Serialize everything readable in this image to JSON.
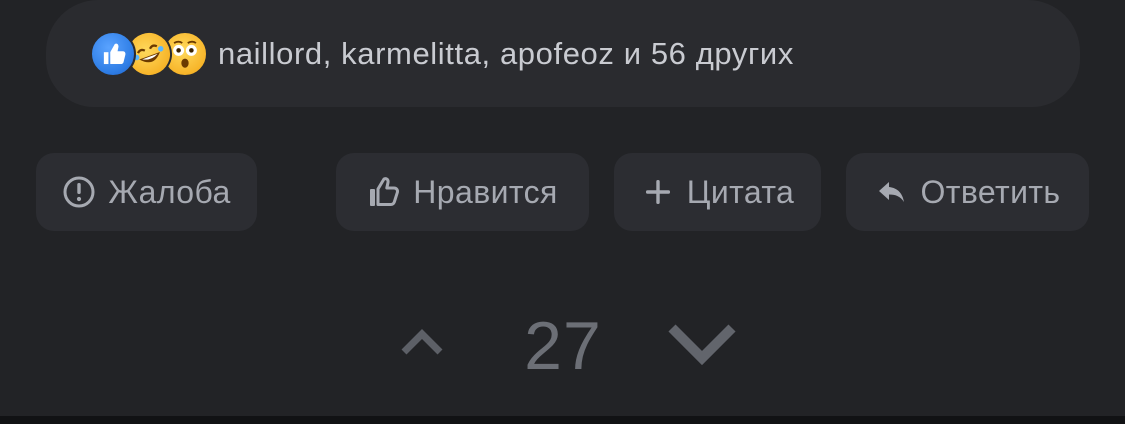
{
  "reactions": {
    "icons": [
      "thumbs-up-icon",
      "rofl-emoji-icon",
      "astonished-emoji-icon"
    ],
    "summary": "naillord, karmelitta, apofeoz и 56 других"
  },
  "actions": {
    "report_label": "Жалоба",
    "like_label": "Нравится",
    "quote_label": "Цитата",
    "reply_label": "Ответить"
  },
  "vote": {
    "score": "27"
  },
  "colors": {
    "background": "#222326",
    "pill": "#2a2b2f",
    "button": "#2c2d32",
    "text": "#a6a9b1",
    "like_badge": "#2f7ee6",
    "emoji": "#f7b52a"
  }
}
